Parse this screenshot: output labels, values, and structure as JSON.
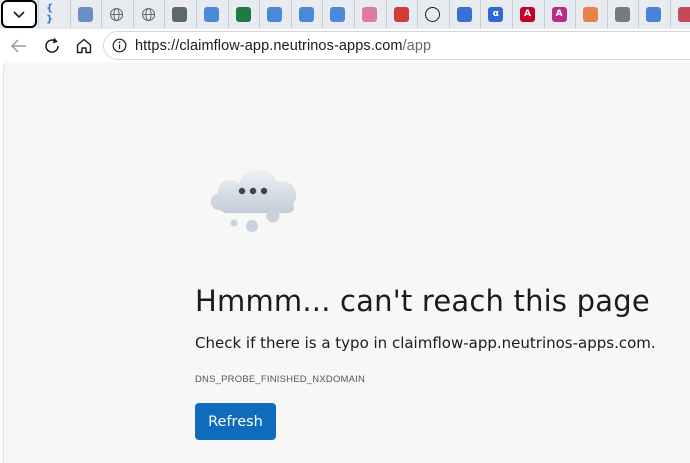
{
  "tabs": [
    {
      "icon": "braces-icon",
      "glyph": "{ }",
      "color": "#3a78c4"
    },
    {
      "icon": "cube-icon",
      "glyph": "",
      "color": "#6a8fc0"
    },
    {
      "icon": "globe-icon",
      "glyph": "",
      "color": "#6b6b6b"
    },
    {
      "icon": "globe-icon",
      "glyph": "",
      "color": "#6b6b6b"
    },
    {
      "icon": "pulse-icon",
      "glyph": "",
      "color": "#5b6b63"
    },
    {
      "icon": "web-page-icon",
      "glyph": "",
      "color": "#4b8ad8"
    },
    {
      "icon": "excel-icon",
      "glyph": "",
      "color": "#1e7a45"
    },
    {
      "icon": "web-page-icon",
      "glyph": "",
      "color": "#4b8ad8"
    },
    {
      "icon": "web-page-icon",
      "glyph": "",
      "color": "#4b8ad8"
    },
    {
      "icon": "web-page-icon",
      "glyph": "",
      "color": "#4b8ad8"
    },
    {
      "icon": "colorful-app-icon",
      "glyph": "",
      "color": "#e07aa0"
    },
    {
      "icon": "headset-icon",
      "glyph": "",
      "color": "#d33a3a"
    },
    {
      "icon": "openai-icon",
      "glyph": "",
      "color": "#1b1b1b"
    },
    {
      "icon": "m-logo-icon",
      "glyph": "",
      "color": "#3a6fd8"
    },
    {
      "icon": "alpha-icon",
      "glyph": "α",
      "color": "#2e6ad1"
    },
    {
      "icon": "angular-icon",
      "glyph": "A",
      "color": "#c3002f"
    },
    {
      "icon": "angular-icon",
      "glyph": "A",
      "color": "#b52e8c"
    },
    {
      "icon": "shield-icon",
      "glyph": "",
      "color": "#e8844a"
    },
    {
      "icon": "document-error-icon",
      "glyph": "",
      "color": "#7a7a7a"
    },
    {
      "icon": "m-logo-icon",
      "glyph": "",
      "color": "#4a82d8"
    },
    {
      "icon": "signature-icon",
      "glyph": "",
      "color": "#c44a5a"
    }
  ],
  "address": {
    "scheme_host": "https://claimflow-app.neutrinos-apps.com",
    "path": "/app"
  },
  "error": {
    "title": "Hmmm... can't reach this page",
    "subtitle": "Check if there is a typo in claimflow-app.neutrinos-apps.com.",
    "code": "DNS_PROBE_FINISHED_NXDOMAIN",
    "refresh_label": "Refresh"
  },
  "colors": {
    "accent": "#0f6cbd",
    "page_bg": "#f7f7f7",
    "tabstrip_bg": "#e8ecf1"
  }
}
